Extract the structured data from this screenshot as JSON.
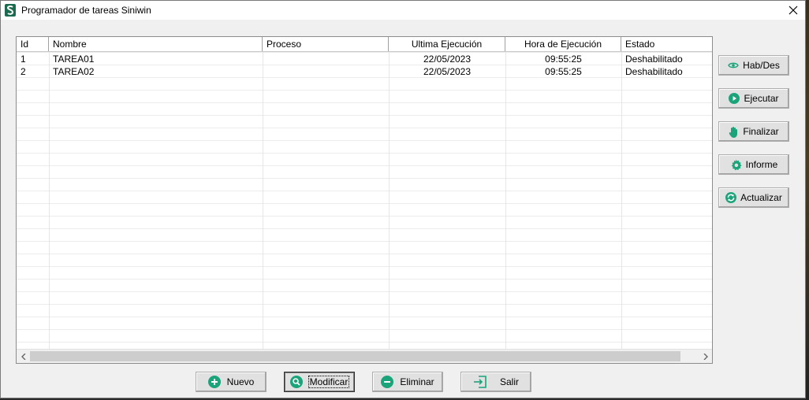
{
  "window": {
    "title": "Programador de tareas Siniwin"
  },
  "grid": {
    "columns": [
      {
        "label": "Id"
      },
      {
        "label": "Nombre"
      },
      {
        "label": "Proceso"
      },
      {
        "label": "Ultima Ejecución"
      },
      {
        "label": "Hora de Ejecución"
      },
      {
        "label": "Estado"
      }
    ],
    "rows": [
      {
        "id": "1",
        "nombre": "TAREA01",
        "proceso": "",
        "ultima": "22/05/2023",
        "hora": "09:55:25",
        "estado": "Deshabilitado"
      },
      {
        "id": "2",
        "nombre": "TAREA02",
        "proceso": "",
        "ultima": "22/05/2023",
        "hora": "09:55:25",
        "estado": "Deshabilitado"
      }
    ]
  },
  "side_buttons": {
    "habdes": "Hab/Des",
    "ejecutar": "Ejecutar",
    "finalizar": "Finalizar",
    "informe": "Informe",
    "actualizar": "Actualizar"
  },
  "bottom_buttons": {
    "nuevo": "Nuevo",
    "modificar": "Modificar",
    "eliminar": "Eliminar",
    "salir": "Salir"
  },
  "colors": {
    "accent": "#1ba37a"
  }
}
